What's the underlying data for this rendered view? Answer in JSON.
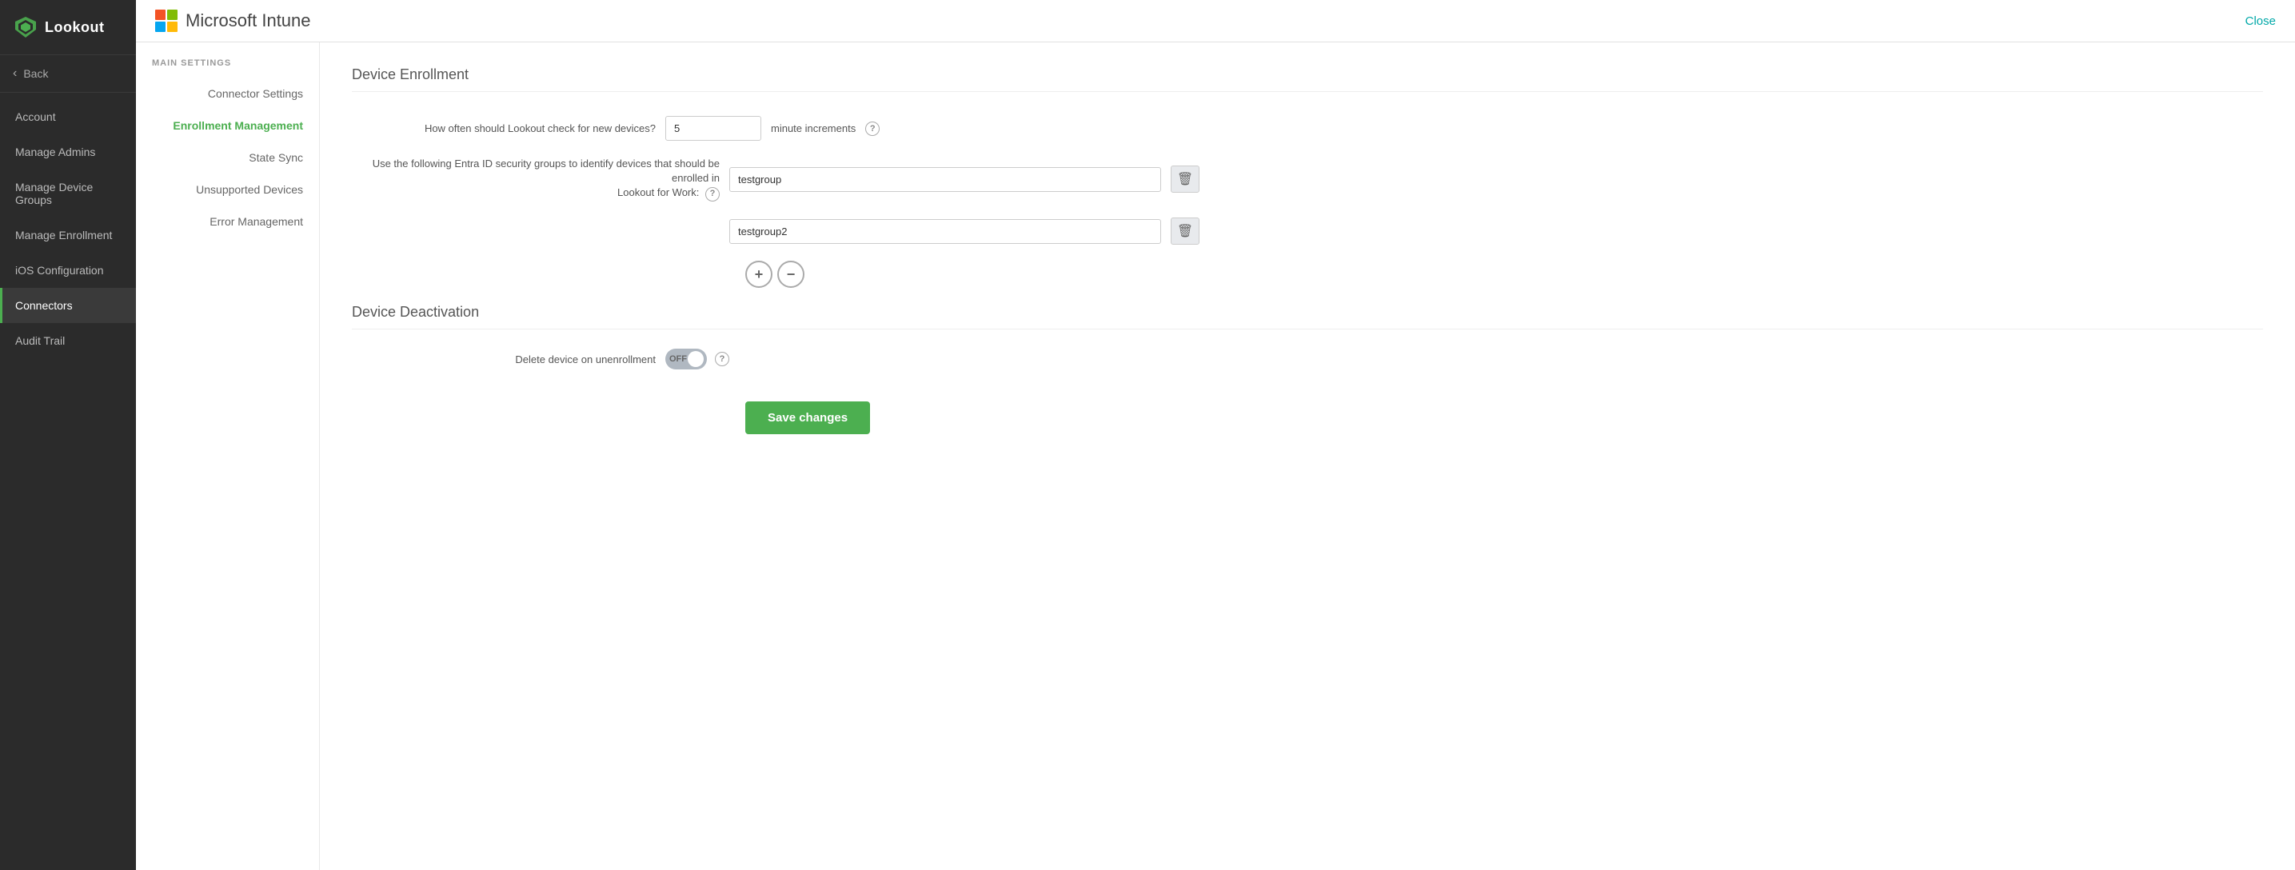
{
  "app": {
    "logo_text": "Lookout",
    "close_label": "Close"
  },
  "header": {
    "app_name": "Microsoft Intune"
  },
  "sidebar": {
    "back_label": "Back",
    "items": [
      {
        "id": "account",
        "label": "Account",
        "active": false
      },
      {
        "id": "manage-admins",
        "label": "Manage Admins",
        "active": false
      },
      {
        "id": "manage-device-groups",
        "label": "Manage Device Groups",
        "active": false
      },
      {
        "id": "manage-enrollment",
        "label": "Manage Enrollment",
        "active": false
      },
      {
        "id": "ios-configuration",
        "label": "iOS Configuration",
        "active": false
      },
      {
        "id": "connectors",
        "label": "Connectors",
        "active": true
      },
      {
        "id": "audit-trail",
        "label": "Audit Trail",
        "active": false
      }
    ]
  },
  "settings_nav": {
    "section_title": "MAIN SETTINGS",
    "items": [
      {
        "id": "connector-settings",
        "label": "Connector Settings",
        "active": false
      },
      {
        "id": "enrollment-management",
        "label": "Enrollment Management",
        "active": true
      },
      {
        "id": "state-sync",
        "label": "State Sync",
        "active": false
      },
      {
        "id": "unsupported-devices",
        "label": "Unsupported Devices",
        "active": false
      },
      {
        "id": "error-management",
        "label": "Error Management",
        "active": false
      }
    ]
  },
  "device_enrollment": {
    "section_title": "Device Enrollment",
    "check_frequency_label": "How often should Lookout check for new devices?",
    "check_frequency_value": "5",
    "check_frequency_unit": "minute increments",
    "entra_label_line1": "Use the following Entra ID security groups to identify devices that should be enrolled in",
    "entra_label_line2": "Lookout for Work:",
    "group1_value": "testgroup",
    "group2_value": "testgroup2",
    "add_button": "+",
    "remove_button": "−"
  },
  "device_deactivation": {
    "section_title": "Device Deactivation",
    "delete_label": "Delete device on unenrollment",
    "toggle_state": "OFF"
  },
  "save_button": {
    "label": "Save changes"
  }
}
